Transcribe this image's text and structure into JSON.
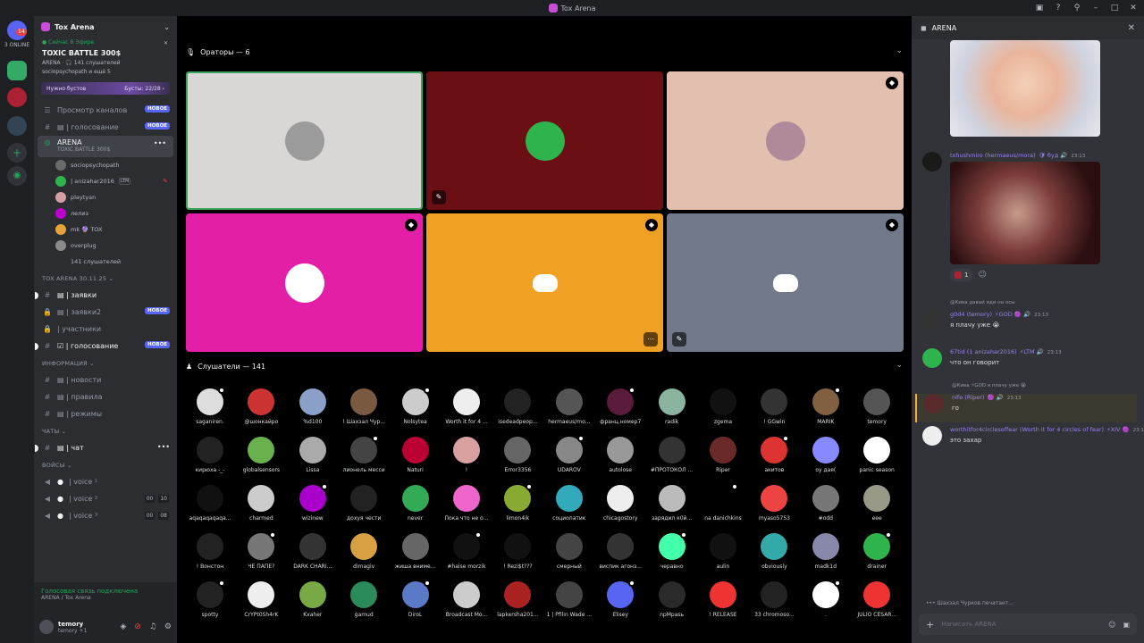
{
  "window": {
    "title": "Tox Arena"
  },
  "guilds": {
    "online_label": "3 ONLINE",
    "badge": "14"
  },
  "server": {
    "name": "Tox Arena",
    "event": {
      "live_label": "● Сейчас В Эфире",
      "title": "TOXIC BATTLE 300$",
      "listeners": "ARENA · 🎧 141 слушателей",
      "users": "sociopsychopath и ещё 5"
    },
    "boost": {
      "label": "Нужно бустов",
      "value": "Бусты: 22/28 ›"
    },
    "channels": [
      {
        "icon": "☰",
        "name": "Просмотр каналов",
        "badge": "НОВОЕ"
      },
      {
        "icon": "#",
        "name": "▤ | голосование",
        "badge": "НОВОЕ"
      }
    ],
    "arena": {
      "name": "ARENA",
      "sub": "TOXIC BATTLE 300$"
    },
    "voice_users": [
      {
        "name": "sociopsychopath",
        "color": "#6b6b6b"
      },
      {
        "name": "| anizahar2016",
        "tag": "LTM",
        "color": "#2fb34d"
      },
      {
        "name": "playtyan",
        "color": "#d4a0a8"
      },
      {
        "name": "лелиз",
        "color": "#b0c"
      },
      {
        "name": "mk 🔮 TOX",
        "color": "#e8a33a"
      },
      {
        "name": "overplug",
        "color": "#8a8a8a"
      },
      {
        "name": "141 слушателей",
        "color": "#2b2d31"
      }
    ],
    "cat1": "TOX ARENA 30.11.25 ⌄",
    "group1": [
      {
        "icon": "#",
        "name": "▤ | заявки",
        "bright": true
      },
      {
        "icon": "🔒",
        "name": "▤ | заявки2",
        "badge": "НОВОЕ"
      },
      {
        "icon": "🔒",
        "name": "| участники"
      },
      {
        "icon": "#",
        "name": "☑ | голосование",
        "badge": "НОВОЕ",
        "bright": true
      }
    ],
    "cat2": "ИНФОРМАЦИЯ ⌄",
    "group2": [
      {
        "icon": "#",
        "name": "▤ | новости"
      },
      {
        "icon": "#",
        "name": "▤ | правила"
      },
      {
        "icon": "#",
        "name": "▤ | режимы"
      }
    ],
    "cat3": "ЧАТЫ ⌄",
    "chat_channel": {
      "icon": "#",
      "name": "▤ | чат"
    },
    "cat4": "ВОЙСЫ ⌄",
    "voices": [
      {
        "name": "| voice ¹",
        "nums": []
      },
      {
        "name": "| voice ²",
        "nums": [
          "00",
          "10"
        ]
      },
      {
        "name": "| voice ³",
        "nums": [
          "00",
          "08"
        ]
      }
    ]
  },
  "voice_status": {
    "connected": "Голосовая связь подключена",
    "where": "ARENA / Tox Arena"
  },
  "user": {
    "name": "temory",
    "status": "temory +1"
  },
  "stage": {
    "speakers_label": "Ораторы — 6",
    "listeners_label": "Слушатели — 141",
    "tiles": [
      {
        "bg": "#d9d6d6",
        "avatar": "#9b9b9b",
        "border": "#3ba55d"
      },
      {
        "bg": "#6b0f15",
        "avatar": "#2fb34d"
      },
      {
        "bg": "#e2bfae",
        "avatar": "#b08a9a",
        "shield": true
      },
      {
        "bg": "#e31fa8",
        "avatar": "#ffffff",
        "shield": true
      },
      {
        "bg": "#f0a123",
        "discord": true,
        "shield": true
      },
      {
        "bg": "#71798a",
        "discord": true,
        "shield": true
      }
    ],
    "listeners": [
      [
        "saganiren.",
        "@шонкайро",
        "%d100",
        "! Шахзал Чур...",
        "Nolsytea",
        "Worth it for 4 ...",
        "isedeadpeop...",
        "hermaeus/mo...",
        "франц.номер7",
        "radik",
        "zgema",
        "! GGwin",
        "MARIK",
        "temory"
      ],
      [
        "кирюха -_-",
        "globalsensors",
        "Lissa",
        "лионель месси",
        "Naturi",
        "!",
        "Error3356",
        "UDAROV",
        "autolose",
        "#ПРОТОКОЛ ...",
        "Riper",
        "акитов",
        "oy дая(",
        "panic season"
      ],
      [
        "aqaqaqaqaqa...",
        "charmed",
        "wizinew",
        "дохуя чести",
        "never",
        "Пока что не о...",
        "limon4ik",
        "социопатик",
        "chicagostory",
        "зарядил к0й...",
        "na danichkins",
        "myaso5753",
        "#odd",
        "eee"
      ],
      [
        "! Вонстон",
        "ЧЕ ПАПЕ?",
        "DARK CHARI...",
        "dimagiv",
        "жиша вниме...",
        "#haise morzik",
        "! Rezi$t???",
        "смерный",
        "виспик агонз...",
        "черавно",
        "aulin",
        "obviously",
        "madk1d",
        "drainer"
      ],
      [
        "spotty",
        "CrYPt0Sh4rK",
        "Kxaher",
        "gamud",
        "DiroL",
        "Broadcast Mo...",
        "lapkersha201...",
        "1 | Pfilin Wade ...",
        "Elisey",
        "npMpasь",
        "! RELEASE",
        "33 chromoso...",
        ".",
        "JULIO CESAR..."
      ]
    ],
    "listener_colors": [
      [
        "#ddd",
        "#c33",
        "#8aa0c8",
        "#7a5a40",
        "#ccc",
        "#eee",
        "#222",
        "#555",
        "#5a1a3a",
        "#8ab4a0",
        "#111",
        "#333",
        "#806040",
        "#555"
      ],
      [
        "#222",
        "#6ab04c",
        "#aaa",
        "#444",
        "#b03",
        "#d9a0a0",
        "#666",
        "#888",
        "#999",
        "#333",
        "#6a2a2a",
        "#d33",
        "#8888ff",
        "#fff"
      ],
      [
        "#111",
        "#ccc",
        "#a0c",
        "#222",
        "#3a5",
        "#e6c",
        "#8a3",
        "#3ab",
        "#eee",
        "#bbb",
        "#000",
        "#e44",
        "#777",
        "#998"
      ],
      [
        "#222",
        "#777",
        "#333",
        "#d8a040",
        "#666",
        "#111",
        "#111",
        "#444",
        "#333",
        "#4fa",
        "#111",
        "#3aa",
        "#8888aa",
        "#2fb34d"
      ],
      [
        "#222",
        "#eee",
        "#7a4",
        "#2a8a5a",
        "#5a7ac8",
        "#ccc",
        "#a22",
        "#444",
        "#5865f2",
        "#2a2a2a",
        "#e33",
        "#222",
        "#fff",
        "#e33"
      ]
    ]
  },
  "chat": {
    "title": "ARENA",
    "messages": [
      {
        "author": "txhushmiro (hermaeus/mora)",
        "badges": "🛡 буд 🔊",
        "time": "23:13",
        "text": "",
        "color": "#1a1a1a"
      },
      {
        "reply": "@Кива давай иди на осы",
        "author": "g0d4 (temory)",
        "badges": "⚡GOD 🟣 🔊",
        "time": "23:13",
        "text": "я плачу уже 😭",
        "color": "#333"
      },
      {
        "author": "67tid (1 anizahar2016)",
        "badges": "⚡LTM 🔊",
        "time": "23:13",
        "text": "что он говорит",
        "color": "#2fb34d"
      },
      {
        "reply": "@Кива ⚡GOD я плачу уже 😭",
        "author": "nife (Riper)",
        "badges": "🟣 🔊",
        "time": "23:13",
        "text": "го",
        "color": "#5a2a2a"
      },
      {
        "author": "worthitfor4circlesoffear (Worth it for 4 circles of fear)",
        "badges": "⚡XIV 🟣",
        "time": "23:13",
        "text": "это захар",
        "color": "#eee"
      }
    ],
    "reaction_count": "1",
    "typing": "Шахзал Чурков печатает...",
    "placeholder": "Написать ARENA"
  }
}
